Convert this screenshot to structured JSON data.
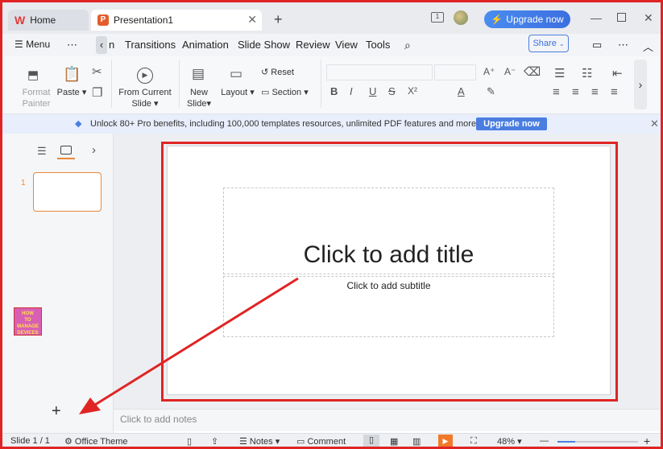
{
  "titlebar": {
    "home_tab": "Home",
    "doc_tab": "Presentation1",
    "upgrade": "Upgrade now",
    "window_count": "1"
  },
  "menubar": {
    "menu": "Menu",
    "items": [
      "n",
      "Transitions",
      "Animation",
      "Slide Show",
      "Review",
      "View",
      "Tools"
    ],
    "share": "Share"
  },
  "ribbon": {
    "format_painter": [
      "Format",
      "Painter"
    ],
    "paste": "Paste",
    "from_current": [
      "From Current",
      "Slide"
    ],
    "new_slide": [
      "New",
      "Slide"
    ],
    "layout": "Layout",
    "reset": "Reset",
    "section": "Section"
  },
  "banner": {
    "text": "Unlock 80+ Pro benefits, including 100,000 templates resources, unlimited PDF features and more.",
    "button": "Upgrade now"
  },
  "panel": {
    "slide_number": "1",
    "logo_text": "HOW TO MANAGE DEVICES"
  },
  "slide": {
    "title_placeholder": "Click to add title",
    "subtitle_placeholder": "Click to add subtitle"
  },
  "notes": "Click to add notes",
  "status": {
    "slide": "Slide 1 / 1",
    "theme": "Office Theme",
    "notes": "Notes",
    "comment": "Comment",
    "zoom": "48%"
  },
  "colors": {
    "annotation_red": "#e02424",
    "accent_blue": "#4a7de0",
    "thumb_orange": "#e8883a"
  }
}
